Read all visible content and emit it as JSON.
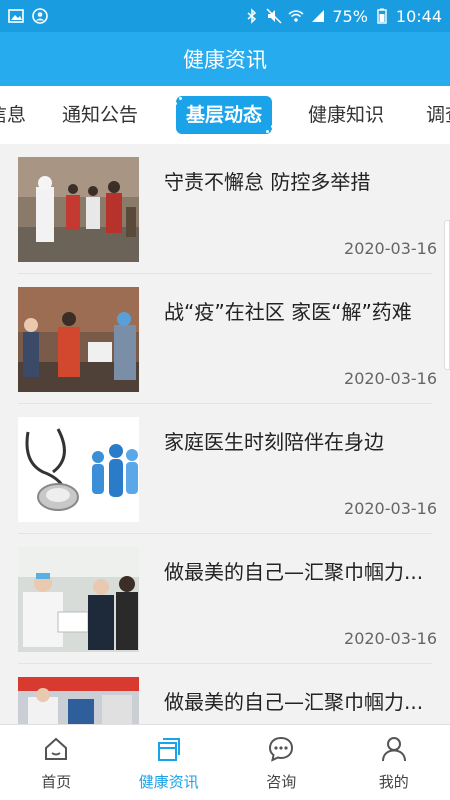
{
  "status_bar": {
    "battery": "75%",
    "time": "10:44"
  },
  "header": {
    "title": "健康资讯"
  },
  "tabs": [
    {
      "label": "信息"
    },
    {
      "label": "通知公告"
    },
    {
      "label": "基层动态"
    },
    {
      "label": "健康知识"
    },
    {
      "label": "调查"
    }
  ],
  "active_tab": "基层动态",
  "articles": [
    {
      "title": "守责不懈怠 防控多举措",
      "date": "2020-03-16"
    },
    {
      "title": "战“疫”在社区 家医“解”药难",
      "date": "2020-03-16"
    },
    {
      "title": "家庭医生时刻陪伴在身边",
      "date": "2020-03-16"
    },
    {
      "title": "做最美的自己—汇聚巾帼力...",
      "date": "2020-03-16"
    },
    {
      "title": "做最美的自己—汇聚巾帼力...",
      "date": ""
    }
  ],
  "bottom_nav": [
    {
      "label": "首页",
      "icon": "home-icon"
    },
    {
      "label": "健康资讯",
      "icon": "news-icon"
    },
    {
      "label": "咨询",
      "icon": "chat-icon"
    },
    {
      "label": "我的",
      "icon": "person-icon"
    }
  ],
  "active_nav": "健康资讯",
  "colors": {
    "brand": "#27abef",
    "accent": "#1aa3e8"
  }
}
